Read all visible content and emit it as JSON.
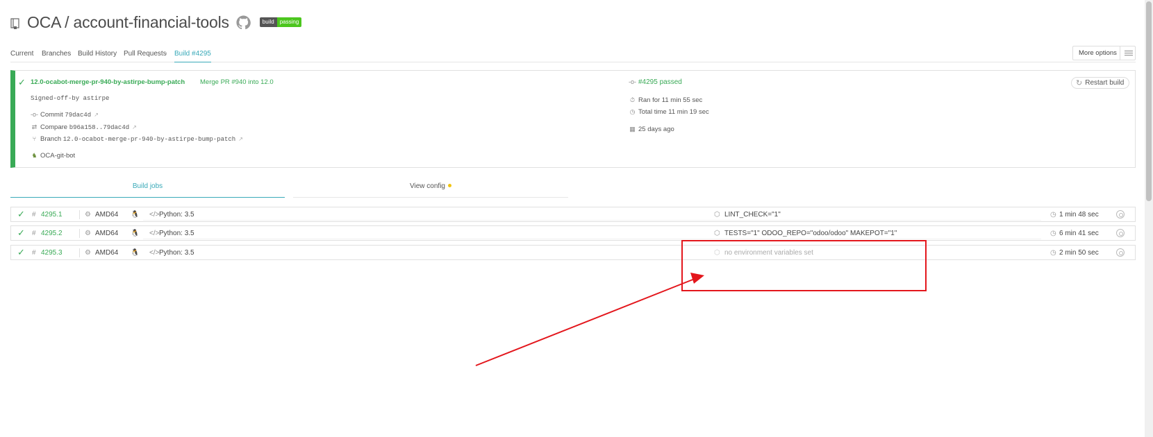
{
  "header": {
    "repo_title": "OCA / account-financial-tools",
    "badge_left": "build",
    "badge_right": "passing"
  },
  "nav": {
    "tabs": [
      {
        "label": "Current"
      },
      {
        "label": "Branches"
      },
      {
        "label": "Build History"
      },
      {
        "label": "Pull Requests"
      },
      {
        "label": "Build #4295"
      }
    ],
    "more_options": "More options"
  },
  "build": {
    "branch_name": "12.0-ocabot-merge-pr-940-by-astirpe-bump-patch",
    "pr_title": "Merge PR #940 into 12.0",
    "message": "Signed-off-by astirpe",
    "commit_label": "Commit",
    "commit_sha": "79dac4d",
    "compare_label": "Compare",
    "compare_range": "b96a158..79dac4d",
    "branch_label": "Branch",
    "branch_value": "12.0-ocabot-merge-pr-940-by-astirpe-bump-patch",
    "author": "OCA-git-bot",
    "status": "#4295 passed",
    "ran_for": "Ran for 11 min 55 sec",
    "total_time": "Total time 11 min 19 sec",
    "finished": "25 days ago",
    "restart_label": "Restart build"
  },
  "job_tabs": {
    "build_jobs": "Build jobs",
    "view_config": "View config"
  },
  "jobs": [
    {
      "number": "4295.1",
      "arch": "AMD64",
      "language": "Python: 3.5",
      "env": "LINT_CHECK=\"1\"",
      "duration": "1 min 48 sec"
    },
    {
      "number": "4295.2",
      "arch": "AMD64",
      "language": "Python: 3.5",
      "env": "TESTS=\"1\" ODOO_REPO=\"odoo/odoo\" MAKEPOT=\"1\"",
      "duration": "6 min 41 sec"
    },
    {
      "number": "4295.3",
      "arch": "AMD64",
      "language": "Python: 3.5",
      "env": "no environment variables set",
      "duration": "2 min 50 sec"
    }
  ],
  "colors": {
    "passed": "#39aa56",
    "accent": "#38a9b8",
    "annotation": "#e3161c"
  }
}
